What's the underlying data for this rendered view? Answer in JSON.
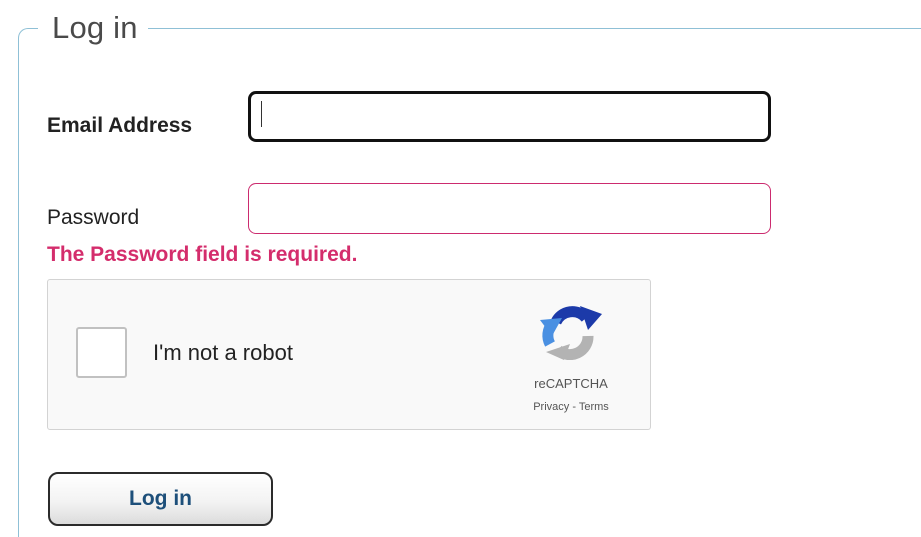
{
  "form": {
    "legend": "Log in",
    "email": {
      "label": "Email Address",
      "value": ""
    },
    "password": {
      "label": "Password",
      "value": "",
      "error": "The Password field is required."
    },
    "captcha": {
      "checkbox_label": "I'm not a robot",
      "brand": "reCAPTCHA",
      "privacy_link": "Privacy",
      "separator": " - ",
      "terms_link": "Terms",
      "checked": false
    },
    "submit_label": "Log in"
  },
  "colors": {
    "fieldset_border": "#8fc0d6",
    "error": "#d42d6c",
    "button_text": "#1d4f7a",
    "captcha_blue": "#1c3aa9",
    "captcha_lightblue": "#4a90e2",
    "captcha_gray": "#b3b3b3"
  },
  "icons": {
    "captcha_logo": "recaptcha-logo-icon"
  }
}
